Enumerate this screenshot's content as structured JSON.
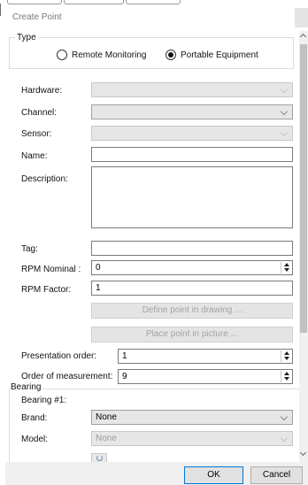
{
  "window": {
    "title": "Create Point"
  },
  "type_group": {
    "legend": "Type",
    "options": [
      {
        "label": "Remote Monitoring",
        "selected": false
      },
      {
        "label": "Portable Equipment",
        "selected": true
      }
    ]
  },
  "form": {
    "hardware": {
      "label": "Hardware:",
      "value": ""
    },
    "channel": {
      "label": "Channel:",
      "value": ""
    },
    "sensor": {
      "label": "Sensor:",
      "value": ""
    },
    "name": {
      "label": "Name:",
      "value": ""
    },
    "description": {
      "label": "Description:",
      "value": ""
    },
    "tag": {
      "label": "Tag:",
      "value": ""
    },
    "rpm_nominal": {
      "label": "RPM Nominal :",
      "value": "0"
    },
    "rpm_factor": {
      "label": "RPM Factor:",
      "value": "1"
    },
    "define_button": "Define point in drawing ...",
    "place_button": "Place point in picture ...",
    "presentation_order": {
      "label": "Presentation order:",
      "value": "1"
    },
    "order_measurement": {
      "label": "Order of measurement:",
      "value": "9"
    }
  },
  "bearing": {
    "legend": "Bearing",
    "subheading": "Bearing #1:",
    "brand": {
      "label": "Brand:",
      "value": "None"
    },
    "model": {
      "label": "Model:",
      "value": "None"
    }
  },
  "buttons": {
    "ok": "OK",
    "cancel": "Cancel"
  },
  "icons": [
    "radio-unselected-icon",
    "radio-selected-icon",
    "chevron-down-icon",
    "spin-up-icon",
    "spin-down-icon",
    "refresh-icon",
    "scroll-up-icon",
    "scroll-down-icon"
  ]
}
